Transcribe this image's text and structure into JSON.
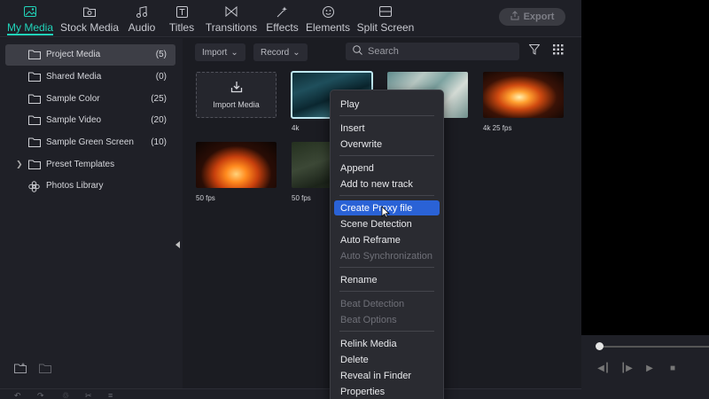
{
  "tabs": [
    {
      "label": "My Media",
      "icon": "image-icon"
    },
    {
      "label": "Stock Media",
      "icon": "folder-icon"
    },
    {
      "label": "Audio",
      "icon": "music-note-icon"
    },
    {
      "label": "Titles",
      "icon": "text-icon"
    },
    {
      "label": "Transitions",
      "icon": "bowtie-icon"
    },
    {
      "label": "Effects",
      "icon": "sparkle-icon"
    },
    {
      "label": "Elements",
      "icon": "smiley-icon"
    },
    {
      "label": "Split Screen",
      "icon": "split-screen-icon"
    }
  ],
  "active_tab": "My Media",
  "export_label": "Export",
  "sidebar": {
    "items": [
      {
        "label": "Project Media",
        "count": "(5)"
      },
      {
        "label": "Shared Media",
        "count": "(0)"
      },
      {
        "label": "Sample Color",
        "count": "(25)"
      },
      {
        "label": "Sample Video",
        "count": "(20)"
      },
      {
        "label": "Sample Green Screen",
        "count": "(10)"
      },
      {
        "label": "Preset Templates",
        "count": ""
      },
      {
        "label": "Photos Library",
        "count": ""
      }
    ]
  },
  "toolbar": {
    "import_label": "Import",
    "record_label": "Record",
    "search_placeholder": "Search"
  },
  "media": {
    "import_tile_label": "Import Media",
    "captions": [
      "4k",
      "4k 25 fps",
      "50 fps",
      "50 fps"
    ]
  },
  "context_menu": {
    "items": [
      {
        "label": "Play",
        "enabled": true
      },
      {
        "label": "Insert",
        "enabled": true
      },
      {
        "label": "Overwrite",
        "enabled": true
      },
      {
        "label": "Append",
        "enabled": true
      },
      {
        "label": "Add to new track",
        "enabled": true
      },
      {
        "label": "Create Proxy file",
        "enabled": true,
        "highlighted": true
      },
      {
        "label": "Scene Detection",
        "enabled": true
      },
      {
        "label": "Auto Reframe",
        "enabled": true
      },
      {
        "label": "Auto Synchronization",
        "enabled": false
      },
      {
        "label": "Rename",
        "enabled": true
      },
      {
        "label": "Beat Detection",
        "enabled": false
      },
      {
        "label": "Beat Options",
        "enabled": false
      },
      {
        "label": "Relink Media",
        "enabled": true
      },
      {
        "label": "Delete",
        "enabled": true
      },
      {
        "label": "Reveal in Finder",
        "enabled": true
      },
      {
        "label": "Properties",
        "enabled": true
      }
    ]
  },
  "colors": {
    "accent": "#21d3b9",
    "menu_highlight": "#2a62d6"
  }
}
